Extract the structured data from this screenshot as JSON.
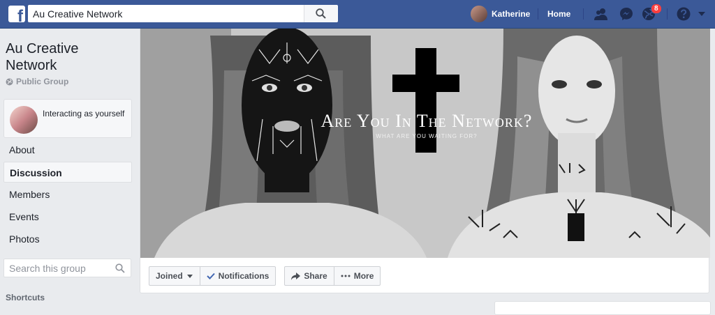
{
  "topbar": {
    "logo": "f",
    "search_value": "Au Creative Network",
    "user_name": "Katherine",
    "home_label": "Home",
    "notification_count": "8",
    "icons": [
      "search-icon",
      "friends-icon",
      "messenger-icon",
      "globe-icon",
      "help-icon",
      "chevron-down-icon"
    ],
    "brand_color": "#3b5998"
  },
  "sidebar": {
    "group_name": "Au Creative Network",
    "privacy": "Public Group",
    "interacting": "Interacting as yourself",
    "nav": [
      {
        "label": "About"
      },
      {
        "label": "Discussion",
        "active": true
      },
      {
        "label": "Members"
      },
      {
        "label": "Events"
      },
      {
        "label": "Photos"
      }
    ],
    "search_placeholder": "Search this group",
    "shortcuts_label": "Shortcuts"
  },
  "cover": {
    "title": "Are You In The Network?",
    "subtitle": "WHAT ARE YOU WAITING FOR?"
  },
  "actions": {
    "joined": "Joined",
    "notifications": "Notifications",
    "share": "Share",
    "more": "More"
  }
}
